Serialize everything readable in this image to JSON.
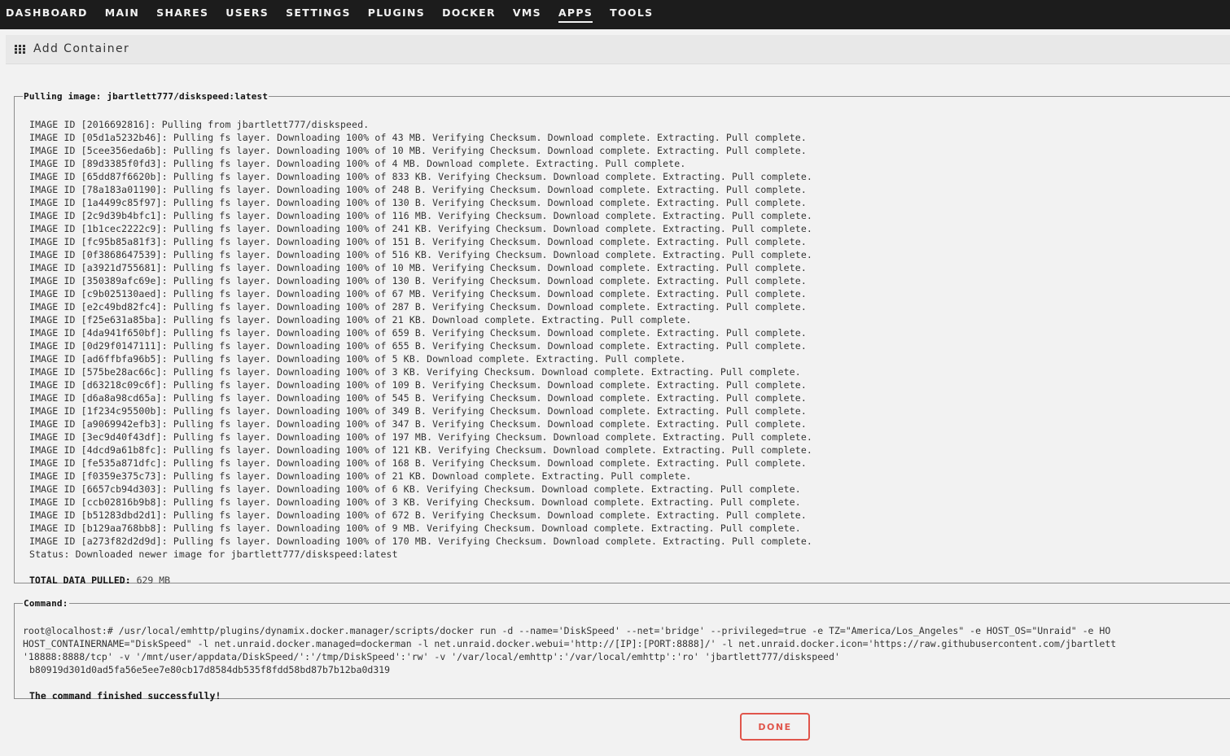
{
  "nav": {
    "items": [
      {
        "label": "DASHBOARD",
        "active": false
      },
      {
        "label": "MAIN",
        "active": false
      },
      {
        "label": "SHARES",
        "active": false
      },
      {
        "label": "USERS",
        "active": false
      },
      {
        "label": "SETTINGS",
        "active": false
      },
      {
        "label": "PLUGINS",
        "active": false
      },
      {
        "label": "DOCKER",
        "active": false
      },
      {
        "label": "VMS",
        "active": false
      },
      {
        "label": "APPS",
        "active": true
      },
      {
        "label": "TOOLS",
        "active": false
      }
    ]
  },
  "page": {
    "icon": "grid-icon",
    "title": "Add Container"
  },
  "pull": {
    "legend": "Pulling image: jbartlett777/diskspeed:latest",
    "lines": [
      "IMAGE ID [2016692816]: Pulling from jbartlett777/diskspeed.",
      "IMAGE ID [05d1a5232b46]: Pulling fs layer. Downloading 100% of 43 MB. Verifying Checksum. Download complete. Extracting. Pull complete.",
      "IMAGE ID [5cee356eda6b]: Pulling fs layer. Downloading 100% of 10 MB. Verifying Checksum. Download complete. Extracting. Pull complete.",
      "IMAGE ID [89d3385f0fd3]: Pulling fs layer. Downloading 100% of 4 MB. Download complete. Extracting. Pull complete.",
      "IMAGE ID [65dd87f6620b]: Pulling fs layer. Downloading 100% of 833 KB. Verifying Checksum. Download complete. Extracting. Pull complete.",
      "IMAGE ID [78a183a01190]: Pulling fs layer. Downloading 100% of 248 B. Verifying Checksum. Download complete. Extracting. Pull complete.",
      "IMAGE ID [1a4499c85f97]: Pulling fs layer. Downloading 100% of 130 B. Verifying Checksum. Download complete. Extracting. Pull complete.",
      "IMAGE ID [2c9d39b4bfc1]: Pulling fs layer. Downloading 100% of 116 MB. Verifying Checksum. Download complete. Extracting. Pull complete.",
      "IMAGE ID [1b1cec2222c9]: Pulling fs layer. Downloading 100% of 241 KB. Verifying Checksum. Download complete. Extracting. Pull complete.",
      "IMAGE ID [fc95b85a81f3]: Pulling fs layer. Downloading 100% of 151 B. Verifying Checksum. Download complete. Extracting. Pull complete.",
      "IMAGE ID [0f3868647539]: Pulling fs layer. Downloading 100% of 516 KB. Verifying Checksum. Download complete. Extracting. Pull complete.",
      "IMAGE ID [a3921d755681]: Pulling fs layer. Downloading 100% of 10 MB. Verifying Checksum. Download complete. Extracting. Pull complete.",
      "IMAGE ID [350389afc69e]: Pulling fs layer. Downloading 100% of 130 B. Verifying Checksum. Download complete. Extracting. Pull complete.",
      "IMAGE ID [c9b025130aed]: Pulling fs layer. Downloading 100% of 67 MB. Verifying Checksum. Download complete. Extracting. Pull complete.",
      "IMAGE ID [e2c49bd82fc4]: Pulling fs layer. Downloading 100% of 287 B. Verifying Checksum. Download complete. Extracting. Pull complete.",
      "IMAGE ID [f25e631a85ba]: Pulling fs layer. Downloading 100% of 21 KB. Download complete. Extracting. Pull complete.",
      "IMAGE ID [4da941f650bf]: Pulling fs layer. Downloading 100% of 659 B. Verifying Checksum. Download complete. Extracting. Pull complete.",
      "IMAGE ID [0d29f0147111]: Pulling fs layer. Downloading 100% of 655 B. Verifying Checksum. Download complete. Extracting. Pull complete.",
      "IMAGE ID [ad6ffbfa96b5]: Pulling fs layer. Downloading 100% of 5 KB. Download complete. Extracting. Pull complete.",
      "IMAGE ID [575be28ac66c]: Pulling fs layer. Downloading 100% of 3 KB. Verifying Checksum. Download complete. Extracting. Pull complete.",
      "IMAGE ID [d63218c09c6f]: Pulling fs layer. Downloading 100% of 109 B. Verifying Checksum. Download complete. Extracting. Pull complete.",
      "IMAGE ID [d6a8a98cd65a]: Pulling fs layer. Downloading 100% of 545 B. Verifying Checksum. Download complete. Extracting. Pull complete.",
      "IMAGE ID [1f234c95500b]: Pulling fs layer. Downloading 100% of 349 B. Verifying Checksum. Download complete. Extracting. Pull complete.",
      "IMAGE ID [a9069942efb3]: Pulling fs layer. Downloading 100% of 347 B. Verifying Checksum. Download complete. Extracting. Pull complete.",
      "IMAGE ID [3ec9d40f43df]: Pulling fs layer. Downloading 100% of 197 MB. Verifying Checksum. Download complete. Extracting. Pull complete.",
      "IMAGE ID [4dcd9a61b8fc]: Pulling fs layer. Downloading 100% of 121 KB. Verifying Checksum. Download complete. Extracting. Pull complete.",
      "IMAGE ID [fe535a871dfc]: Pulling fs layer. Downloading 100% of 168 B. Verifying Checksum. Download complete. Extracting. Pull complete.",
      "IMAGE ID [f0359e375c73]: Pulling fs layer. Downloading 100% of 21 KB. Download complete. Extracting. Pull complete.",
      "IMAGE ID [6657cb94d303]: Pulling fs layer. Downloading 100% of 6 KB. Verifying Checksum. Download complete. Extracting. Pull complete.",
      "IMAGE ID [ccb02816b9b8]: Pulling fs layer. Downloading 100% of 3 KB. Verifying Checksum. Download complete. Extracting. Pull complete.",
      "IMAGE ID [b51283dbd2d1]: Pulling fs layer. Downloading 100% of 672 B. Verifying Checksum. Download complete. Extracting. Pull complete.",
      "IMAGE ID [b129aa768bb8]: Pulling fs layer. Downloading 100% of 9 MB. Verifying Checksum. Download complete. Extracting. Pull complete.",
      "IMAGE ID [a273f82d2d9d]: Pulling fs layer. Downloading 100% of 170 MB. Verifying Checksum. Download complete. Extracting. Pull complete.",
      "Status: Downloaded newer image for jbartlett777/diskspeed:latest"
    ],
    "total_label": "TOTAL DATA PULLED:",
    "total_value": "629 MB"
  },
  "command": {
    "legend": "Command:",
    "lines": [
      "root@localhost:# /usr/local/emhttp/plugins/dynamix.docker.manager/scripts/docker run -d --name='DiskSpeed' --net='bridge' --privileged=true -e TZ=\"America/Los_Angeles\" -e HOST_OS=\"Unraid\" -e HO",
      "HOST_CONTAINERNAME=\"DiskSpeed\" -l net.unraid.docker.managed=dockerman -l net.unraid.docker.webui='http://[IP]:[PORT:8888]/' -l net.unraid.docker.icon='https://raw.githubusercontent.com/jbartlett",
      "'18888:8888/tcp' -v '/mnt/user/appdata/DiskSpeed/':'/tmp/DiskSpeed':'rw' -v '/var/local/emhttp':'/var/local/emhttp':'ro' 'jbartlett777/diskspeed'"
    ],
    "container_id": "b80919d301d0ad5fa56e5ee7e80cb17d8584db535f8fdd58bd87b7b12ba0d319",
    "success": "The command finished successfully!"
  },
  "done_button": {
    "label": "DONE"
  },
  "colors": {
    "nav_bg": "#1c1c1c",
    "accent": "#e0554b"
  }
}
